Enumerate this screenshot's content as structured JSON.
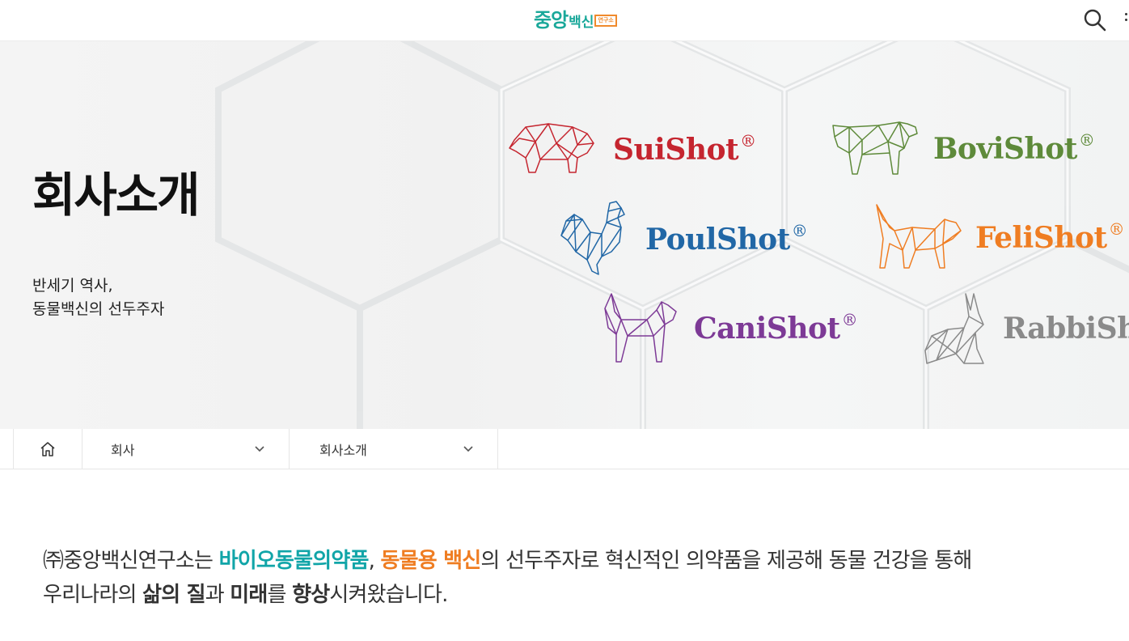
{
  "header": {
    "logo_main": "중앙",
    "logo_sub": "백신",
    "logo_tag": "연구소",
    "search_icon": "search-icon"
  },
  "hero": {
    "title": "회사소개",
    "subtitle_line1": "반세기 역사,",
    "subtitle_line2": "동물백신의 선두주자",
    "brands": [
      {
        "name": "SuiShot",
        "mark": "®",
        "color": "#c5252f",
        "icon": "pig-icon"
      },
      {
        "name": "BoviShot",
        "mark": "®",
        "color": "#5e8a3a",
        "icon": "cow-icon"
      },
      {
        "name": "PoulShot",
        "mark": "®",
        "color": "#2167a6",
        "icon": "rooster-icon"
      },
      {
        "name": "FeliShot",
        "mark": "®",
        "color": "#ef7d22",
        "icon": "cat-icon"
      },
      {
        "name": "CaniShot",
        "mark": "®",
        "color": "#7d3a96",
        "icon": "dog-icon"
      },
      {
        "name": "RabbiSh",
        "mark": "",
        "color": "#8a8a8a",
        "icon": "rabbit-icon"
      }
    ]
  },
  "breadcrumb": {
    "home_icon": "home-icon",
    "level1": "회사",
    "level2": "회사소개"
  },
  "intro": {
    "p1": "㈜중앙백신연구소는 ",
    "h1": "바이오동물의약품",
    "p2": ", ",
    "h2": "동물용 백신",
    "p3": "의 선두주자로 혁신적인 의약품을 제공해 동물 건강을 통해",
    "p4": "우리나라의 ",
    "b1": "삶의 질",
    "p5": "과 ",
    "b2": "미래",
    "p6": "를 ",
    "b3": "향상",
    "p7": "시켜왔습니다."
  },
  "colors": {
    "brand_teal": "#1aa89a",
    "brand_orange": "#f08a2c",
    "highlight_teal": "#11a5a8",
    "highlight_orange": "#ef7d22"
  }
}
